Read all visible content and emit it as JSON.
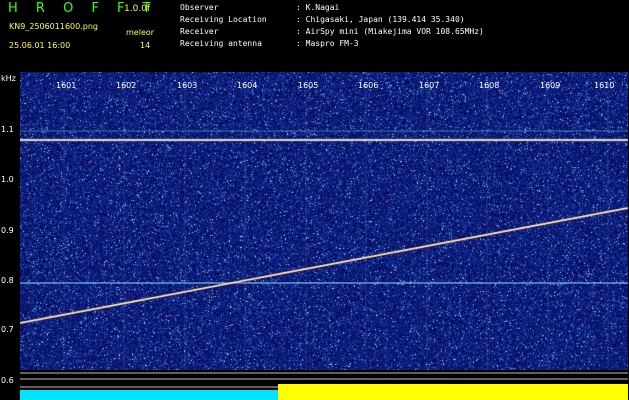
{
  "header": {
    "app_title": "H R O F F T",
    "version": "1.0.0f",
    "filename": "KN9_2506011600.png",
    "datetime": "25.06.01 16:00",
    "mode": "meleor",
    "count": "14"
  },
  "info": [
    {
      "label": "Observer",
      "value": ": K.Nagai"
    },
    {
      "label": "Receiving Location",
      "value": ": Chigasaki, Japan (139.414 35.340)"
    },
    {
      "label": "Receiver",
      "value": ": AirSpy mini (Miakejima VOR 108.65MHz)"
    },
    {
      "label": "Receiving antenna",
      "value": ": Maspro FM-3"
    }
  ],
  "axes": {
    "y_unit": "kHz",
    "x_ticks": [
      "1601",
      "1602",
      "1603",
      "1604",
      "1605",
      "1606",
      "1607",
      "1608",
      "1609",
      "1610"
    ],
    "y_ticks": [
      "1.1",
      "1.0",
      "0.9",
      "0.8",
      "0.7",
      "0.6"
    ]
  },
  "colors": {
    "background": "#000000",
    "spectrum_base": "#0c1a7e",
    "title_green": "#39ff14",
    "label_yellow": "#ffff44",
    "cyan_bar": "#00e5ff",
    "yellow_bar": "#ffff00"
  }
}
